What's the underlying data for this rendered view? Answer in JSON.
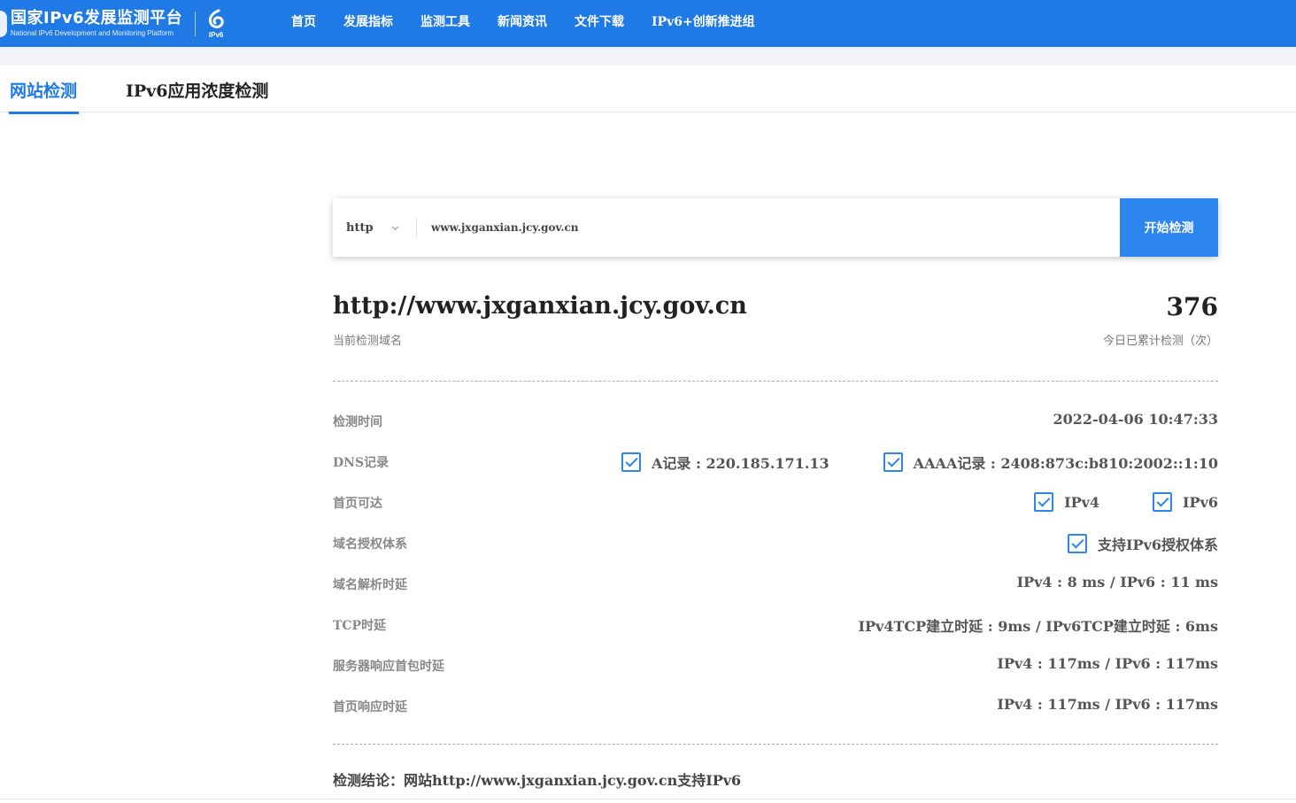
{
  "header": {
    "logo_cn": "国家IPv6发展监测平台",
    "logo_en": "National IPv6 Development and Monitoring Platform",
    "logo_badge": "IPv6",
    "nav": [
      "首页",
      "发展指标",
      "监测工具",
      "新闻资讯",
      "文件下载",
      "IPv6+创新推进组"
    ],
    "brand_color": "#1f7ae6"
  },
  "tabs": {
    "website_check": "网站检测",
    "app_check": "IPv6应用浓度检测"
  },
  "search": {
    "protocol": "http",
    "url": "www.jxganxian.jcy.gov.cn",
    "button": "开始检测"
  },
  "summary": {
    "domain": "http://www.jxganxian.jcy.gov.cn",
    "domain_label": "当前检测域名",
    "count": "376",
    "count_label": "今日已累计检测（次）"
  },
  "results": {
    "time": {
      "label": "检测时间",
      "value": "2022-04-06 10:47:33"
    },
    "dns": {
      "label": "DNS记录",
      "a": "A记录 : 220.185.171.13",
      "aaaa": "AAAA记录 : 2408:873c:b810:2002::1:10"
    },
    "reach": {
      "label": "首页可达",
      "v4": "IPv4",
      "v6": "IPv6"
    },
    "auth": {
      "label": "域名授权体系",
      "value": "支持IPv6授权体系"
    },
    "resolve": {
      "label": "域名解析时延",
      "value": "IPv4 : 8 ms / IPv6 : 11 ms"
    },
    "tcp": {
      "label": "TCP时延",
      "value": "IPv4TCP建立时延 : 9ms / IPv6TCP建立时延 : 6ms"
    },
    "first_byte": {
      "label": "服务器响应首包时延",
      "value": "IPv4 : 117ms / IPv6 : 117ms"
    },
    "page": {
      "label": "首页响应时延",
      "value": "IPv4 : 117ms / IPv6 : 117ms"
    }
  },
  "conclusion": "检测结论：网站http://www.jxganxian.jcy.gov.cn支持IPv6"
}
